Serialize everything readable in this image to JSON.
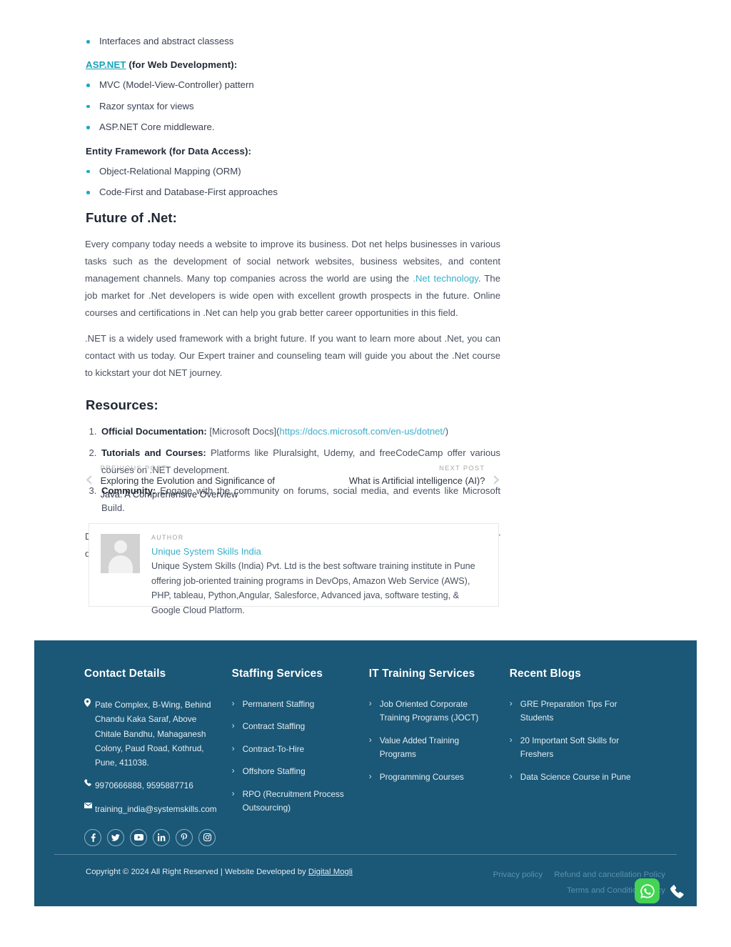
{
  "article": {
    "top_bullets": [
      "Interfaces and abstract classess"
    ],
    "aspnet_heading_link": "ASP.NET",
    "aspnet_heading_rest": " (for Web Development):",
    "aspnet_bullets": [
      "MVC (Model-View-Controller) pattern",
      "Razor syntax for views",
      "ASP.NET Core middleware."
    ],
    "ef_heading": "Entity Framework (for Data Access):",
    "ef_bullets": [
      "Object-Relational Mapping (ORM)",
      "Code-First and Database-First approaches"
    ],
    "future_title": "Future of .Net:",
    "future_p1_a": "Every company today needs a website to improve its business. Dot net helps businesses in various tasks such as the development of social network websites, business websites, and content management channels. Many top companies across the world are using the ",
    "future_p1_link": ".Net technology",
    "future_p1_b": ". The job market for .Net developers is wide open with excellent growth prospects in the future. Online courses and certifications in .Net can help you grab better career opportunities in this field.",
    "future_p2": ".NET is a widely used framework with a bright future. If you want to learn more about .Net, you can contact with us today. Our Expert trainer and counseling team will guide you about the .Net course to kickstart your dot NET journey.",
    "resources_title": "Resources:",
    "resources": [
      {
        "bold": "Official Documentation:",
        "text": " [Microsoft Docs](",
        "link": "https://docs.microsoft.com/en-us/dotnet/",
        "tail": ")"
      },
      {
        "bold": "Tutorials and Courses:",
        "text": " Platforms like Pluralsight, Udemy, and freeCodeCamp offer various courses on .NET development.",
        "link": "",
        "tail": ""
      },
      {
        "bold": "Community:",
        "text": " Engage with the community on forums, social media, and events like Microsoft Build.",
        "link": "",
        "tail": ""
      }
    ],
    "closing_paragraph": "Dot NET's flexibility, cross-platform capabilities, and rich set of libraries make it a popular choice for developers building a wide array of applications, from desktop software to cloud-based services."
  },
  "post_nav": {
    "prev_label": "PREVIOUS POST",
    "prev_title": "Exploring the Evolution and Significance of Java: A Comprehensive Overview",
    "next_label": "NEXT POST",
    "next_title": "What is Artificial intelligence (AI)?",
    "prev_arrow": "‹",
    "next_arrow": "›"
  },
  "author": {
    "label": "AUTHOR",
    "name": "Unique System Skills India",
    "description": "Unique System Skills (India) Pvt. Ltd is the best software training institute in Pune offering job-oriented training programs in DevOps, Amazon Web Service (AWS), PHP, tableau, Python,Angular, Salesforce, Advanced java, software testing, & Google Cloud Platform."
  },
  "footer": {
    "background_color": "#1b5776",
    "contact": {
      "title": "Contact Details",
      "address": "Pate Complex, B-Wing, Behind Chandu Kaka Saraf, Above Chitale Bandhu, Mahaganesh Colony, Paud Road, Kothrud, Pune, 411038.",
      "phone": "9970666888, 9595887716",
      "email": "training_india@systemskills.com",
      "socials": [
        "facebook-icon",
        "twitter-icon",
        "youtube-icon",
        "linkedin-icon",
        "pinterest-icon",
        "instagram-icon"
      ]
    },
    "staffing": {
      "title": "Staffing Services",
      "items": [
        "Permanent Staffing",
        "Contract Staffing",
        "Contract-To-Hire",
        "Offshore Staffing",
        "RPO (Recruitment Process Outsourcing)"
      ]
    },
    "training": {
      "title": "IT Training Services",
      "items": [
        "Job Oriented Corporate Training Programs (JOCT)",
        "Value Added Training Programs",
        "Programming Courses"
      ]
    },
    "blogs": {
      "title": "Recent Blogs",
      "items": [
        "GRE Preparation Tips For Students",
        "20 Important Soft Skills for Freshers",
        "Data Science Course in Pune"
      ]
    },
    "copyright_prefix": "Copyright © 2024 All Right Reserved | Website Developed by ",
    "copyright_link": "Digital Mogli",
    "policy_links": [
      "Privacy policy",
      "Refund and cancellation Policy",
      "Terms and Condition Policy"
    ]
  },
  "floating": {
    "whatsapp_label": "whatsapp-icon",
    "call_label": "phone-icon",
    "whatsapp_color": "#45d354"
  }
}
